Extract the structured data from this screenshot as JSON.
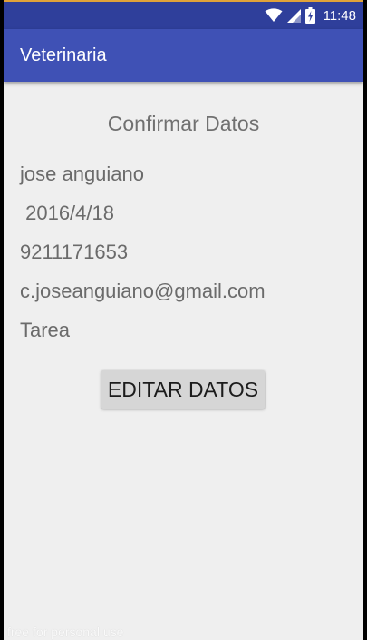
{
  "status_bar": {
    "time": "11:48",
    "icons": [
      "wifi-icon",
      "signal-icon",
      "battery-icon"
    ]
  },
  "app_bar": {
    "title": "Veterinaria"
  },
  "main": {
    "title": "Confirmar Datos",
    "fields": {
      "name": "jose anguiano",
      "date": " 2016/4/18",
      "phone": "9211171653",
      "email": "c.joseanguiano@gmail.com",
      "description": "Tarea"
    },
    "edit_button_label": "EDITAR DATOS"
  },
  "watermark": "free for personal use",
  "colors": {
    "status_bar": "#2f3f9b",
    "app_bar": "#3f51b5",
    "background": "#efefef",
    "button": "#d6d6d6"
  }
}
